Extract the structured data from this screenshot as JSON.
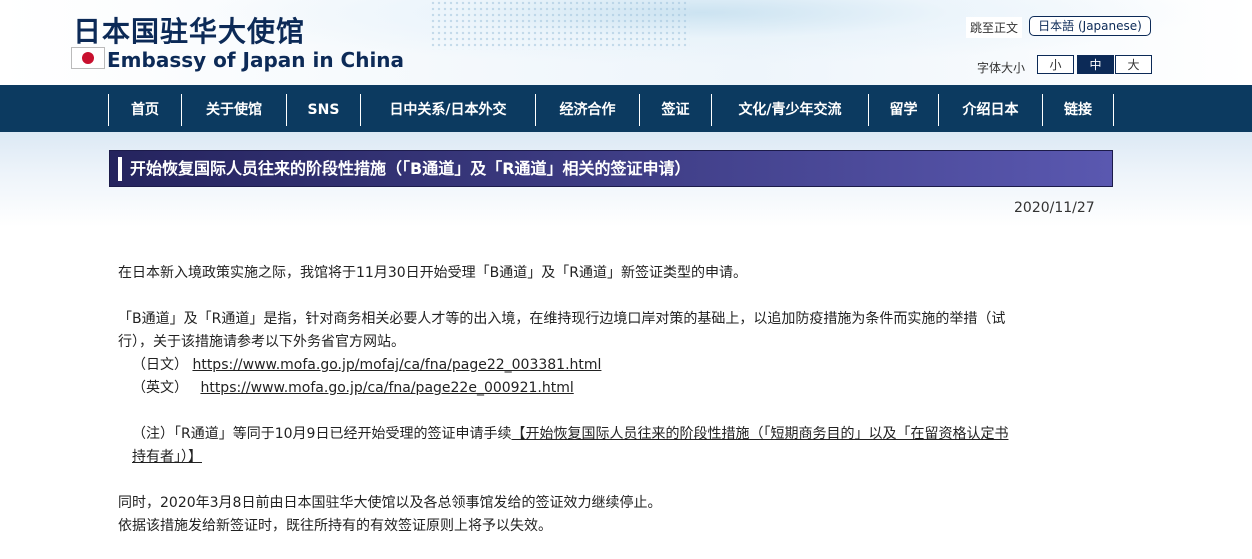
{
  "header": {
    "title_jp": "日本国驻华大使馆",
    "title_en": "Embassy of Japan in China",
    "skip_link": "跳至正文",
    "lang_button": "日本語 (Japanese)",
    "font_size_label": "字体大小",
    "font_sizes": [
      "小",
      "中",
      "大"
    ],
    "font_size_selected": "中"
  },
  "nav": {
    "items": [
      "首页",
      "关于使馆",
      "SNS",
      "日中关系/日本外交",
      "经济合作",
      "签证",
      "文化/青少年交流",
      "留学",
      "介绍日本",
      "链接"
    ]
  },
  "article": {
    "title": "开始恢复国际人员往来的阶段性措施（「B通道」及「R通道」相关的签证申请）",
    "date": "2020/11/27",
    "p1": "在日本新入境政策实施之际，我馆将于11月30日开始受理「B通道」及「R通道」新签证类型的申请。",
    "p2_line1": "「B通道」及「R通道」是指，针对商务相关必要人才等的出入境，在维持现行边境口岸对策的基础上，以追加防疫措施为条件而实施的举措（试",
    "p2_line2": "行），关于该措施请参考以下外务省官方网站。",
    "jp_label": "（日文）",
    "jp_url": "https://www.mofa.go.jp/mofaj/ca/fna/page22_003381.html",
    "en_label": "（英文）",
    "en_url": "https://www.mofa.go.jp/ca/fna/page22e_000921.html",
    "note_prefix": "（注）「R通道」等同于10月9日已经开始受理的签证申请手续",
    "note_link_line1": "【开始恢复国际人员往来的阶段性措施（「短期商务目的」以及「在留资格认定书",
    "note_link_line2": "持有者」）】",
    "p3": "同时，2020年3月8日前由日本国驻华大使馆以及各总领事馆发给的签证效力继续停止。",
    "p4": "依据该措施发给新签证时，既往所持有的有效签证原则上将予以失效。"
  }
}
